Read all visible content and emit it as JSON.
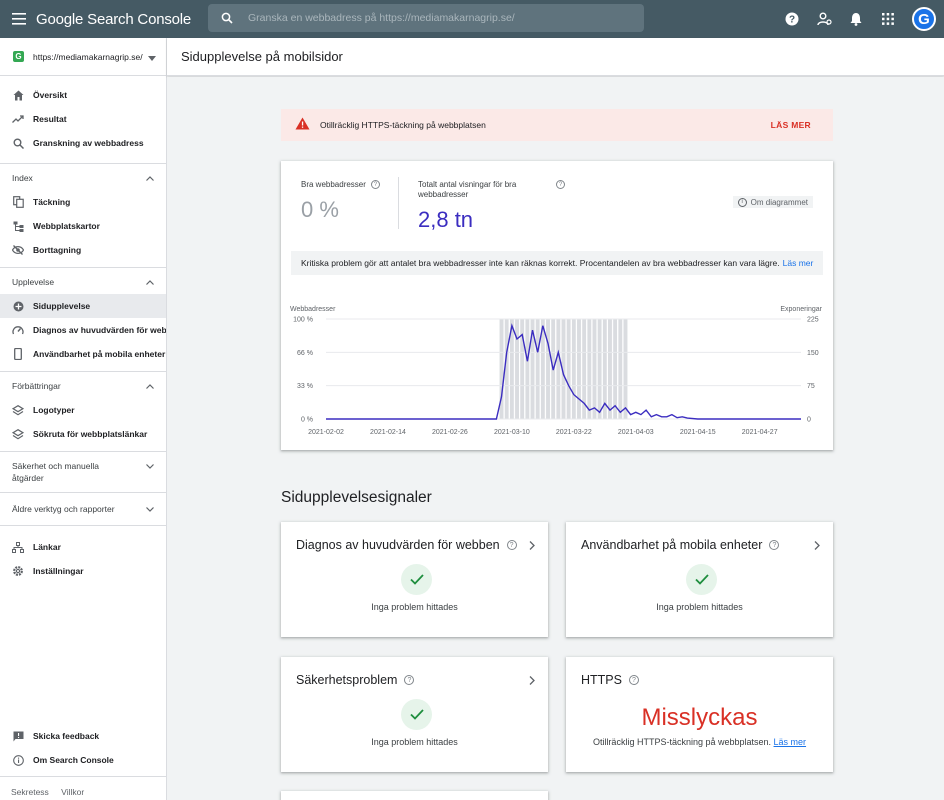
{
  "app": {
    "title": "Google Search Console",
    "search_placeholder": "Granska en webbadress på https://mediamakarnagrip.se/",
    "avatar_letter": "G"
  },
  "sidebar": {
    "property": "https://mediamakarnagrip.se/",
    "top_items": [
      {
        "label": "Översikt",
        "icon": "home-icon"
      },
      {
        "label": "Resultat",
        "icon": "trending-up-icon"
      },
      {
        "label": "Granskning av webbadress",
        "icon": "search-icon"
      }
    ],
    "sections": [
      {
        "title": "Index",
        "items": [
          "Täckning",
          "Webbplatskartor",
          "Borttagning"
        ]
      },
      {
        "title": "Upplevelse",
        "items": [
          "Sidupplevelse",
          "Diagnos av huvudvärden för webben",
          "Användbarhet på mobila enheter"
        ]
      },
      {
        "title": "Förbättringar",
        "items": [
          "Logotyper",
          "Sökruta för webbplatslänkar"
        ]
      }
    ],
    "security_section": "Säkerhet och manuella åtgärder",
    "legacy_section": "Äldre verktyg och rapporter",
    "bottom_items": [
      "Länkar",
      "Inställningar"
    ],
    "footer_items": [
      "Skicka feedback",
      "Om Search Console"
    ],
    "footer_links": [
      "Sekretess",
      "Villkor"
    ]
  },
  "main": {
    "page_title": "Sidupplevelse på mobilsidor",
    "alert": {
      "text": "Otillräcklig HTTPS-täckning på webbplatsen",
      "button": "LÄS MER"
    },
    "metric_good": {
      "label": "Bra webbadresser",
      "value": "0 %"
    },
    "metric_impr": {
      "label": "Totalt antal visningar för bra webbadresser",
      "value": "2,8 tn"
    },
    "about_chart": "Om diagrammet",
    "info_text": "Kritiska problem gör att antalet bra webbadresser inte kan räknas korrekt. Procentandelen av bra webbadresser kan vara lägre.",
    "info_link": "Läs mer",
    "signals_title": "Sidupplevelsesignaler",
    "signals": {
      "cwv": {
        "title": "Diagnos av huvudvärden för webben",
        "status": "Inga problem hittades"
      },
      "mobile": {
        "title": "Användbarhet på mobila enheter",
        "status": "Inga problem hittades"
      },
      "security": {
        "title": "Säkerhetsproblem",
        "status": "Inga problem hittades"
      },
      "https": {
        "title": "HTTPS",
        "status": "Misslyckas",
        "detail": "Otillräcklig HTTPS-täckning på webbplatsen.",
        "link": "Läs mer"
      }
    }
  },
  "colors": {
    "accent": "#3b2dc0",
    "fail": "#d93025",
    "ok": "#1e8e3e",
    "topbar": "#455a64"
  },
  "chart_data": {
    "type": "line",
    "left_axis_label": "Webbadresser",
    "right_axis_label": "Exponeringar",
    "left_ticks": [
      "100 %",
      "66 %",
      "33 %",
      "0 %"
    ],
    "right_ticks": [
      "225",
      "150",
      "75",
      "0"
    ],
    "x_ticks": [
      "2021-02-02",
      "2021-02-14",
      "2021-02-26",
      "2021-03-10",
      "2021-03-22",
      "2021-04-03",
      "2021-04-15",
      "2021-04-27"
    ],
    "x_range": [
      "2021-02-02",
      "2021-05-05"
    ],
    "ylim_right": [
      0,
      225
    ],
    "series": [
      {
        "name": "Exponeringar",
        "axis": "right",
        "x": [
          "2021-02-02",
          "2021-03-07",
          "2021-03-08",
          "2021-03-09",
          "2021-03-10",
          "2021-03-11",
          "2021-03-12",
          "2021-03-13",
          "2021-03-14",
          "2021-03-15",
          "2021-03-16",
          "2021-03-17",
          "2021-03-18",
          "2021-03-19",
          "2021-03-20",
          "2021-03-21",
          "2021-03-22",
          "2021-03-23",
          "2021-03-24",
          "2021-03-25",
          "2021-03-26",
          "2021-03-27",
          "2021-03-28",
          "2021-03-29",
          "2021-03-30",
          "2021-03-31",
          "2021-04-01",
          "2021-04-02",
          "2021-04-03",
          "2021-04-04",
          "2021-04-05",
          "2021-04-06",
          "2021-04-07",
          "2021-04-08",
          "2021-04-09",
          "2021-04-10",
          "2021-04-11",
          "2021-04-12",
          "2021-04-13",
          "2021-04-15",
          "2021-05-05"
        ],
        "values": [
          0,
          0,
          50,
          150,
          210,
          180,
          190,
          130,
          200,
          150,
          210,
          170,
          110,
          150,
          100,
          75,
          55,
          45,
          35,
          20,
          25,
          15,
          35,
          20,
          30,
          15,
          25,
          10,
          15,
          10,
          20,
          5,
          10,
          5,
          5,
          10,
          3,
          5,
          2,
          0,
          0
        ]
      }
    ],
    "shaded_range": [
      "2021-03-08",
      "2021-04-01"
    ],
    "legend": "none",
    "grid": true
  }
}
